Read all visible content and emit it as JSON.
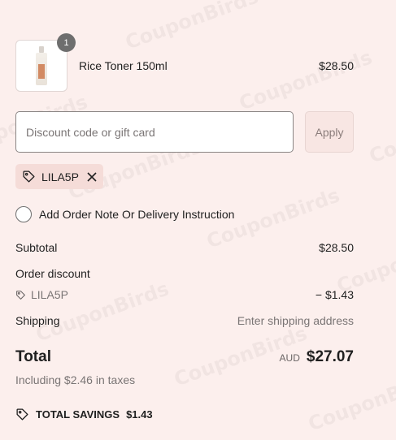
{
  "product": {
    "name": "Rice Toner 150ml",
    "price": "$28.50",
    "quantity": "1"
  },
  "discount": {
    "placeholder": "Discount code or gift card",
    "apply_label": "Apply",
    "applied_code": "LILA5P"
  },
  "order_note": {
    "label": "Add Order Note Or Delivery Instruction"
  },
  "summary": {
    "subtotal_label": "Subtotal",
    "subtotal_value": "$28.50",
    "order_discount_label": "Order discount",
    "discount_code": "LILA5P",
    "discount_value": "− $1.43",
    "shipping_label": "Shipping",
    "shipping_value": "Enter shipping address",
    "total_label": "Total",
    "currency": "AUD",
    "total_value": "$27.07",
    "taxes_note": "Including $2.46 in taxes",
    "savings_label": "TOTAL SAVINGS",
    "savings_value": "$1.43"
  },
  "colors": {
    "background": "#fcefed",
    "chip": "#f5dcd8",
    "apply_button": "#f8e6e3"
  },
  "watermark": "CouponBirds"
}
